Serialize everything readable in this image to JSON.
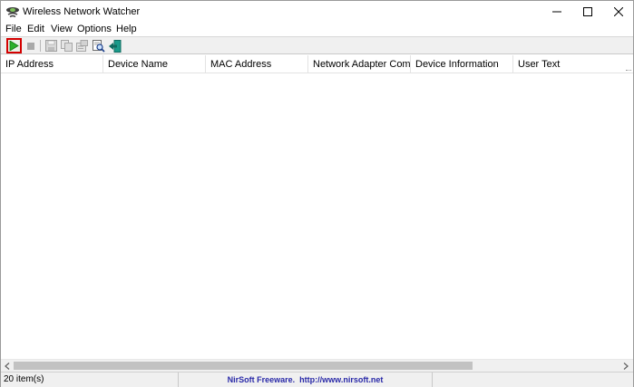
{
  "window": {
    "title": "Wireless Network Watcher",
    "controls": [
      "minimize",
      "maximize",
      "close"
    ]
  },
  "menu": [
    {
      "label": "File"
    },
    {
      "label": "Edit"
    },
    {
      "label": "View"
    },
    {
      "label": "Options"
    },
    {
      "label": "Help"
    }
  ],
  "toolbar": {
    "buttons": [
      {
        "icon": "play-icon",
        "state": "highlighted",
        "color": "#2bb02b"
      },
      {
        "icon": "stop-icon",
        "state": "disabled"
      },
      {
        "icon": "save-icon",
        "state": "disabled"
      },
      {
        "icon": "copy-icon",
        "state": "disabled"
      },
      {
        "icon": "properties-icon",
        "state": "disabled"
      },
      {
        "icon": "find-icon",
        "state": "enabled"
      },
      {
        "icon": "exit-icon",
        "state": "enabled",
        "color": "#1a9a8a"
      }
    ]
  },
  "list": {
    "columns": [
      "IP Address",
      "Device Name",
      "MAC Address",
      "Network Adapter Comp",
      "Device Information",
      "User Text"
    ],
    "rows": []
  },
  "status": {
    "items": "20 item(s)",
    "link": "NirSoft Freeware.  http://www.nirsoft.net"
  },
  "colors": {
    "highlight_border": "#d40000",
    "link": "#2a2aa8"
  }
}
